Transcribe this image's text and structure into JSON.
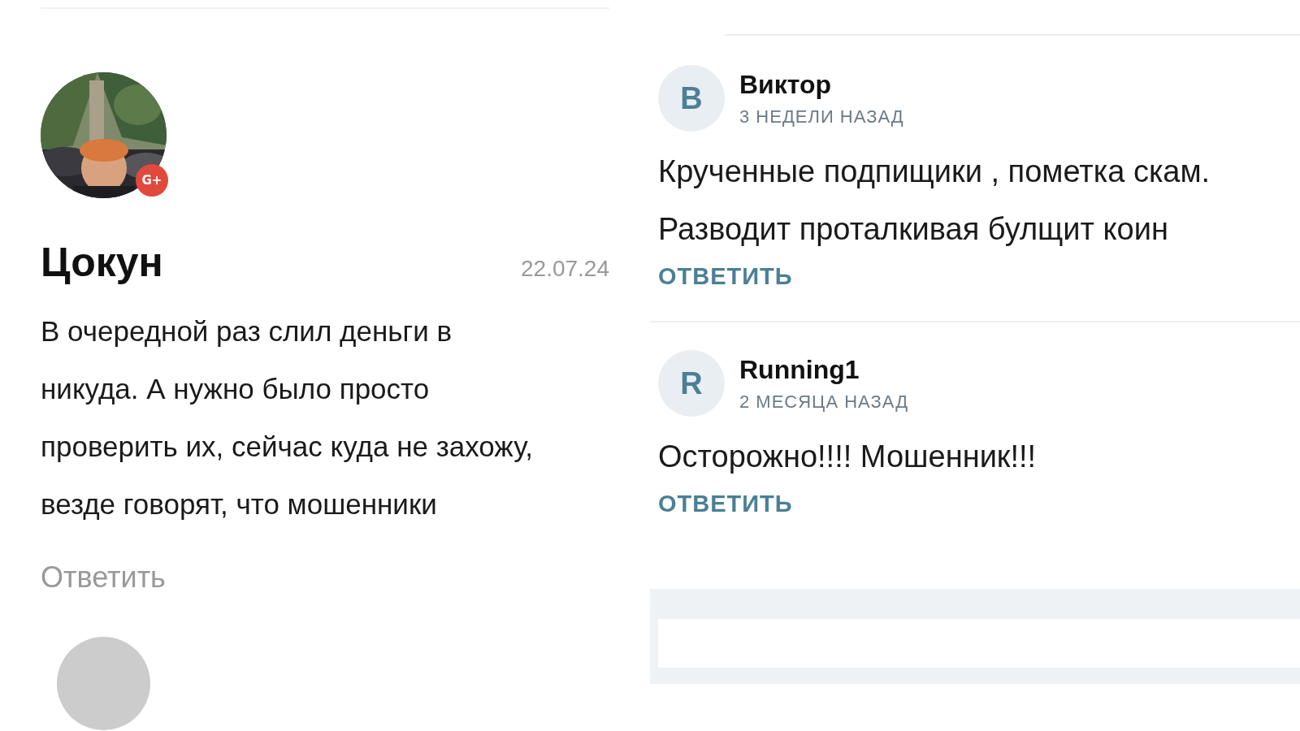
{
  "review": {
    "author": "Цокун",
    "badge": "G+",
    "date": "22.07.24",
    "text": "В очередной раз слил деньги в никуда. А нужно было просто проверить их, сейчас куда не захожу, везде говорят, что мошенники",
    "reply": "Ответить"
  },
  "comments": [
    {
      "initial": "B",
      "author": "Виктор",
      "time": "3 НЕДЕЛИ НАЗАД",
      "text": "Крученные подпищики , пометка скам. Разводит проталкивая булщит коин",
      "reply": "ОТВЕТИТЬ"
    },
    {
      "initial": "R",
      "author": "Running1",
      "time": "2 МЕСЯЦА НАЗАД",
      "text": "Осторожно!!!! Мошенник!!!",
      "reply": "ОТВЕТИТЬ"
    }
  ]
}
